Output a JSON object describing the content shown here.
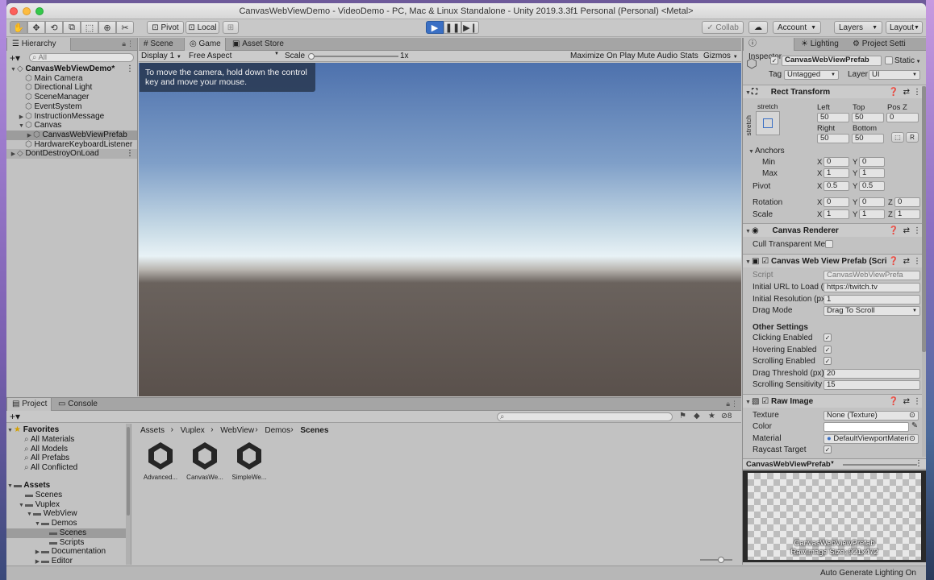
{
  "window": {
    "title": "CanvasWebViewDemo - VideoDemo - PC, Mac & Linux Standalone - Unity 2019.3.3f1 Personal (Personal) <Metal>"
  },
  "toolbar": {
    "pivot_label": "Pivot",
    "local_label": "Local",
    "collab_label": "Collab",
    "account_label": "Account",
    "layers_label": "Layers",
    "layout_label": "Layout"
  },
  "hierarchy": {
    "tab_label": "Hierarchy",
    "search_placeholder": "All",
    "items": [
      {
        "label": "CanvasWebViewDemo*",
        "depth": 0
      },
      {
        "label": "Main Camera",
        "depth": 1
      },
      {
        "label": "Directional Light",
        "depth": 1
      },
      {
        "label": "SceneManager",
        "depth": 1
      },
      {
        "label": "EventSystem",
        "depth": 1
      },
      {
        "label": "InstructionMessage",
        "depth": 1
      },
      {
        "label": "Canvas",
        "depth": 1
      },
      {
        "label": "CanvasWebViewPrefab",
        "depth": 2
      },
      {
        "label": "HardwareKeyboardListener",
        "depth": 1
      },
      {
        "label": "DontDestroyOnLoad",
        "depth": 0
      }
    ]
  },
  "game": {
    "tabs": [
      "Scene",
      "Game",
      "Asset Store"
    ],
    "display_label": "Display 1",
    "aspect_label": "Free Aspect",
    "scale_label": "Scale",
    "scale_value": "1x",
    "maximize_label": "Maximize On Play",
    "mute_label": "Mute Audio",
    "stats_label": "Stats",
    "gizmos_label": "Gizmos",
    "instruction_line1": "To move the camera, hold down the control",
    "instruction_line2": "key and move your mouse."
  },
  "project": {
    "tabs": [
      "Project",
      "Console"
    ],
    "breadcrumb": [
      "Assets",
      "Vuplex",
      "WebView",
      "Demos",
      "Scenes"
    ],
    "favorites_label": "Favorites",
    "favorites": [
      "All Materials",
      "All Models",
      "All Prefabs",
      "All Conflicted"
    ],
    "assets_label": "Assets",
    "asset_tree": [
      {
        "label": "Scenes",
        "depth": 1
      },
      {
        "label": "Vuplex",
        "depth": 1
      },
      {
        "label": "WebView",
        "depth": 2
      },
      {
        "label": "Demos",
        "depth": 3
      },
      {
        "label": "Scenes",
        "depth": 4
      },
      {
        "label": "Scripts",
        "depth": 4
      },
      {
        "label": "Documentation",
        "depth": 3
      },
      {
        "label": "Editor",
        "depth": 3
      }
    ],
    "files": [
      "Advanced...",
      "CanvasWe...",
      "SimpleWe..."
    ],
    "badge_count": "8"
  },
  "inspector": {
    "tabs": [
      "Inspector",
      "Lighting",
      "Project Setti"
    ],
    "object_name": "CanvasWebViewPrefab",
    "static_label": "Static",
    "tag_label": "Tag",
    "tag_value": "Untagged",
    "layer_label": "Layer",
    "layer_value": "UI",
    "rect_transform": {
      "title": "Rect Transform",
      "stretch_label": "stretch",
      "left_label": "Left",
      "left": "50",
      "top_label": "Top",
      "top": "50",
      "posz_label": "Pos Z",
      "posz": "0",
      "right_label": "Right",
      "right": "50",
      "bottom_label": "Bottom",
      "bottom": "50",
      "anchors_label": "Anchors",
      "min_label": "Min",
      "min_x": "0",
      "min_y": "0",
      "max_label": "Max",
      "max_x": "1",
      "max_y": "1",
      "pivot_label": "Pivot",
      "pivot_x": "0.5",
      "pivot_y": "0.5",
      "rotation_label": "Rotation",
      "rot_x": "0",
      "rot_y": "0",
      "rot_z": "0",
      "scale_label": "Scale",
      "scale_x": "1",
      "scale_y": "1",
      "scale_z": "1",
      "r_button": "R"
    },
    "canvas_renderer": {
      "title": "Canvas Renderer",
      "cull_label": "Cull Transparent Mes"
    },
    "script_comp": {
      "title": "Canvas Web View Prefab (Scri",
      "script_label": "Script",
      "script_value": "CanvasWebViewPrefa",
      "url_label": "Initial URL to Load (O",
      "url_value": "https://twitch.tv",
      "res_label": "Initial Resolution (px /",
      "res_value": "1",
      "drag_label": "Drag Mode",
      "drag_value": "Drag To Scroll",
      "other_settings": "Other Settings",
      "clicking_label": "Clicking Enabled",
      "hovering_label": "Hovering Enabled",
      "scrolling_label": "Scrolling Enabled",
      "threshold_label": "Drag Threshold (px)",
      "threshold_value": "20",
      "sensitivity_label": "Scrolling Sensitivity",
      "sensitivity_value": "15"
    },
    "raw_image": {
      "title": "Raw Image",
      "texture_label": "Texture",
      "texture_value": "None (Texture)",
      "color_label": "Color",
      "material_label": "Material",
      "material_value": "DefaultViewportMateri",
      "raycast_label": "Raycast Target"
    },
    "preview": {
      "title": "CanvasWebViewPrefab",
      "caption1": "CanvasWebViewPrefab",
      "caption2": "RawImage Size: 921x472"
    }
  },
  "status": {
    "text": "Auto Generate Lighting On"
  },
  "colors": {
    "play_active": "#3a6fc4",
    "sky_top": "#4d71ad",
    "sky_horizon": "#e8f2f6",
    "ground": "#5a514c"
  }
}
